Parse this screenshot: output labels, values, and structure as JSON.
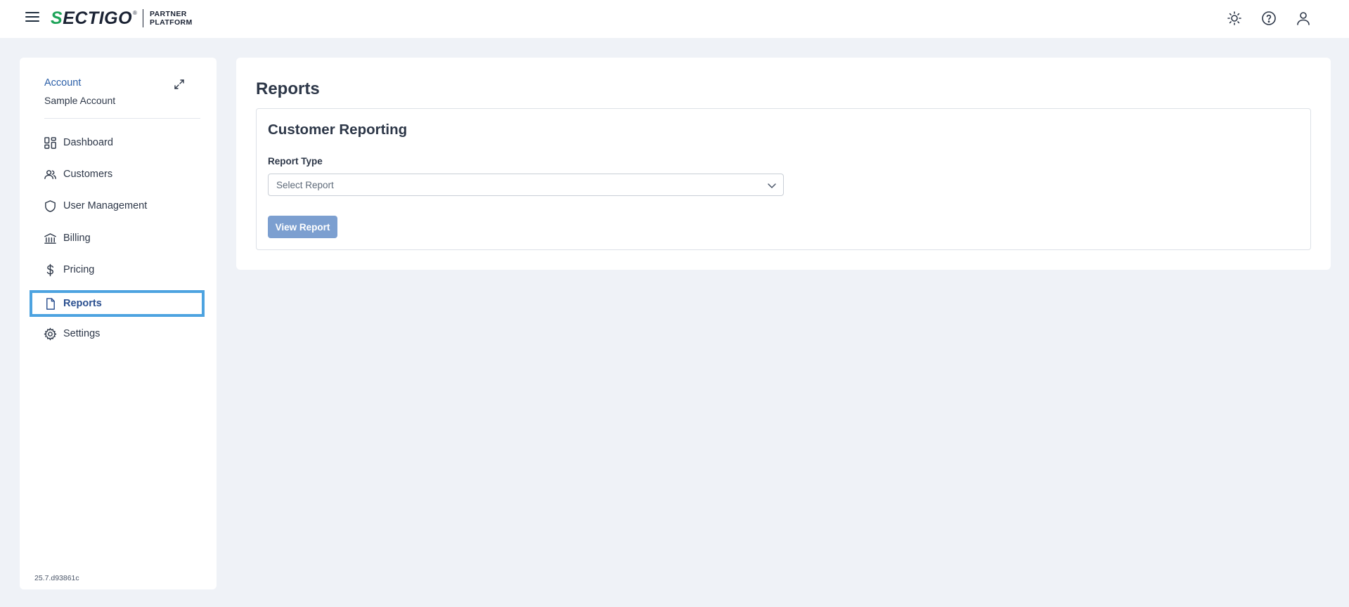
{
  "header": {
    "logo": {
      "brand": "SECTIGO",
      "registered": "®",
      "line1": "PARTNER",
      "line2": "PLATFORM"
    },
    "icons": [
      "menu-icon",
      "sun-icon",
      "help-icon",
      "user-icon"
    ]
  },
  "sidebar": {
    "account_label": "Account",
    "account_name": "Sample Account",
    "items": [
      {
        "label": "Dashboard",
        "icon": "dashboard-icon"
      },
      {
        "label": "Customers",
        "icon": "users-icon"
      },
      {
        "label": "User Management",
        "icon": "shield-icon"
      },
      {
        "label": "Billing",
        "icon": "bank-icon"
      },
      {
        "label": "Pricing",
        "icon": "dollar-icon"
      },
      {
        "label": "Reports",
        "icon": "file-icon",
        "active": true
      },
      {
        "label": "Settings",
        "icon": "gear-icon"
      }
    ],
    "version": "25.7.d93861c"
  },
  "main": {
    "title": "Reports",
    "card": {
      "title": "Customer Reporting",
      "field_label": "Report Type",
      "select_placeholder": "Select Report",
      "button_label": "View Report"
    }
  },
  "colors": {
    "background": "#eff2f7",
    "accent": "#2b5fa8",
    "active_outline": "#4da3e0",
    "button": "#7c9fd0",
    "brand_green": "#1fa45a"
  }
}
